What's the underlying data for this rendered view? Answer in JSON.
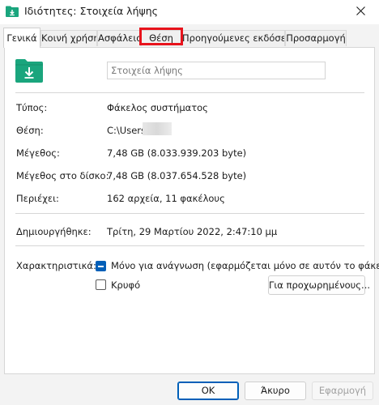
{
  "window": {
    "title": "Ιδιότητες: Στοιχεία λήψης",
    "title_icon": "folder-download-icon",
    "close_icon": "close-icon"
  },
  "tabs": [
    {
      "label": "Γενικά",
      "active": true
    },
    {
      "label": "Κοινή χρήση",
      "active": false
    },
    {
      "label": "Ασφάλεια",
      "active": false
    },
    {
      "label": "Θέση",
      "active": false,
      "highlighted": true
    },
    {
      "label": "Προηγούμενες εκδόσεις",
      "active": false
    },
    {
      "label": "Προσαρμογή",
      "active": false
    }
  ],
  "general": {
    "folder_icon": "folder-download-icon",
    "folder_name": "Στοιχεία λήψης",
    "type_label": "Τύπος:",
    "type_value": "Φάκελος συστήματος",
    "location_label": "Θέση:",
    "location_value": "C:\\Users",
    "size_label": "Μέγεθος:",
    "size_value": "7,48 GB (8.033.939.203 byte)",
    "disk_size_label": "Μέγεθος στο δίσκο:",
    "disk_size_value": "7,48 GB (8.037.654.528 byte)",
    "contains_label": "Περιέχει:",
    "contains_value": "162 αρχεία, 11 φακέλους",
    "created_label": "Δημιουργήθηκε:",
    "created_value": "Τρίτη, 29 Μαρτίου 2022, 2:47:10 μμ",
    "attributes_label": "Χαρακτηριστικά:",
    "readonly_label": "Μόνο για ανάγνωση (εφαρμόζεται μόνο σε αυτόν το φάκελο)",
    "readonly_state": "indeterminate",
    "hidden_label": "Κρυφό",
    "hidden_state": "unchecked",
    "advanced_button": "Για προχωρημένους..."
  },
  "footer": {
    "ok": "OK",
    "cancel": "Άκυρο",
    "apply": "Εφαρμογή",
    "apply_enabled": false
  },
  "colors": {
    "accent": "#005fb8",
    "highlight_box": "#e8131c",
    "folder": "#1aa57d"
  }
}
